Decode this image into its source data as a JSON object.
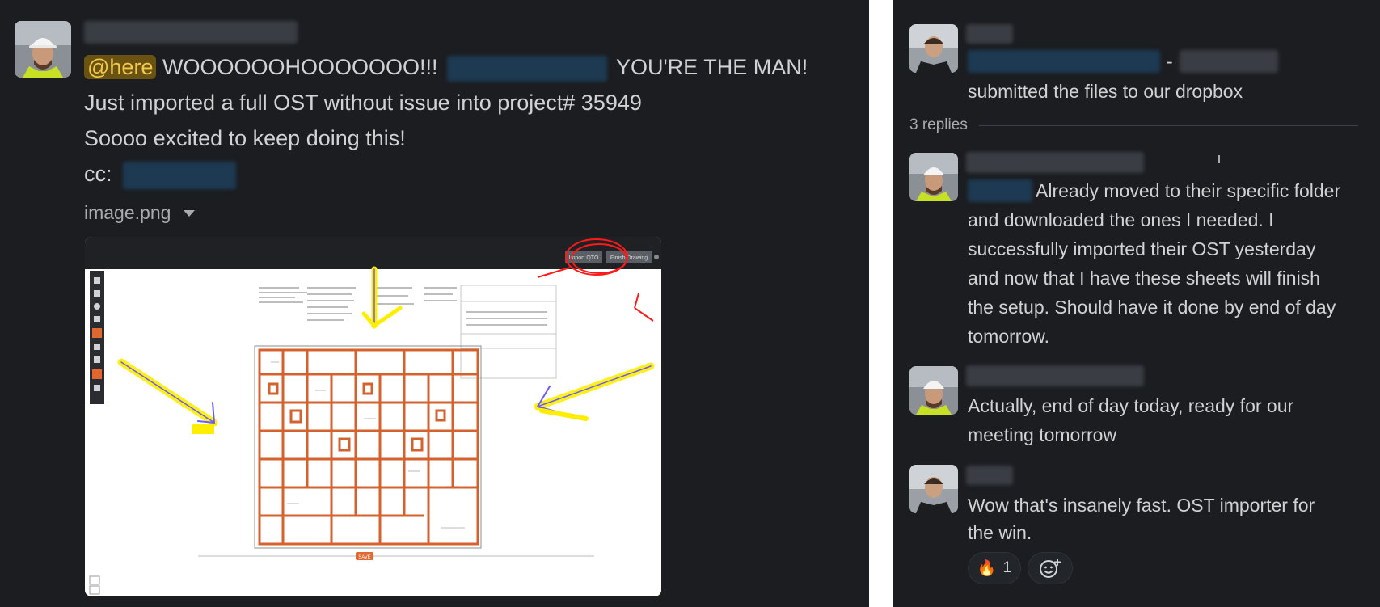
{
  "left_message": {
    "mention": "@here",
    "exclaim": "WOOOOOOHOOOOOOO!!!",
    "shout": "YOU'RE THE MAN!",
    "line2": "Just imported a full OST without issue into project# 35949",
    "line3": "Soooo excited to keep doing this!",
    "cc_label": "cc:",
    "attachment_name": "image.png"
  },
  "attachment_ui": {
    "import_button": "Import QTO",
    "finish_button": "Finish Drawing",
    "save_button": "SAVE"
  },
  "thread": {
    "parent_tail": "-",
    "parent_text": "submitted the files to our dropbox",
    "replies_count": "3 replies",
    "replies": [
      {
        "lines": [
          "Already moved to their specific folder",
          "and downloaded the ones I needed. I",
          "successfully imported their OST yesterday",
          "and now that I have these sheets will finish",
          "the setup. Should have it done by end of day",
          "tomorrow."
        ]
      },
      {
        "lines": [
          "Actually, end of day today, ready for our",
          "meeting tomorrow"
        ]
      },
      {
        "lines": [
          "Wow that's insanely fast. OST importer for",
          "the win."
        ]
      }
    ],
    "reaction": {
      "emoji": "🔥",
      "count": "1",
      "icon": "fire-emoji"
    },
    "add_reaction_icon": "add-reaction-icon"
  },
  "colors": {
    "background": "#1b1d21",
    "text": "#d1d2d3",
    "mention_bg": "#6a5312",
    "mention_fg": "#f2c94c",
    "markup_orange": "#d4622f"
  }
}
